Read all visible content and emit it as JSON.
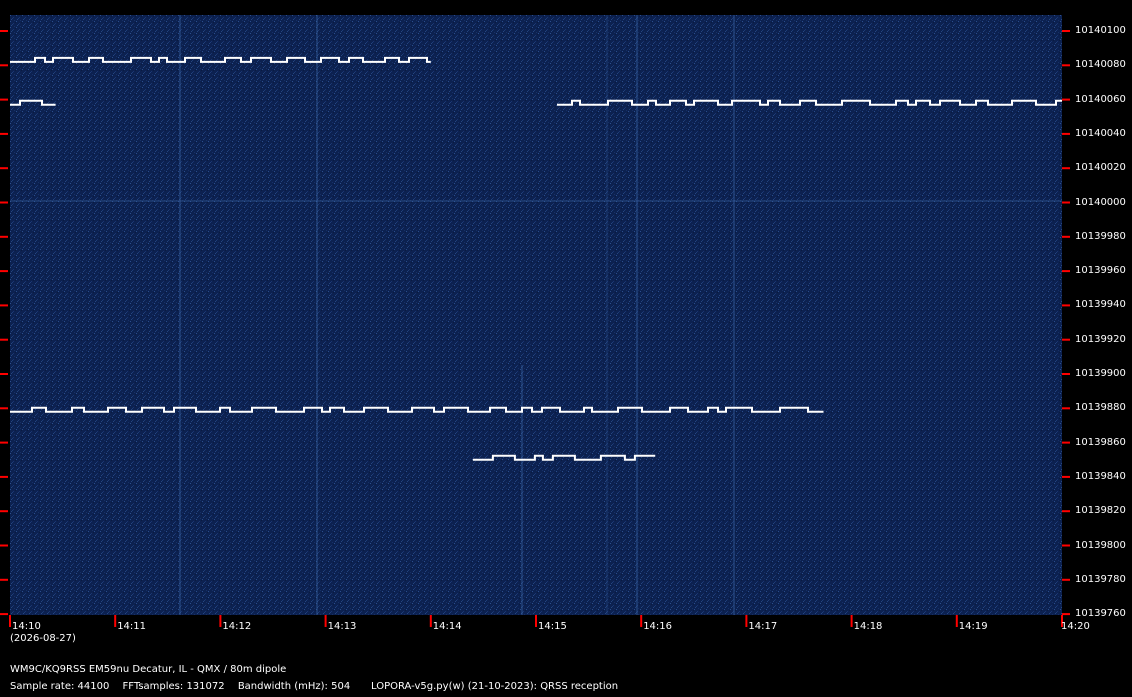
{
  "colors": {
    "background": "#000000",
    "waterfall": "#0c2150",
    "tick": "#ff0000",
    "signal": "#ffffff",
    "text": "#ffffff"
  },
  "frequency_axis": {
    "unit": "Hz",
    "labels": [
      "10140100",
      "10140080",
      "10140060",
      "10140040",
      "10140020",
      "10140000",
      "10139980",
      "10139960",
      "10139940",
      "10139920",
      "10139900",
      "10139880",
      "10139860",
      "10139840",
      "10139820",
      "10139800",
      "10139780",
      "10139760"
    ]
  },
  "time_axis": {
    "labels": [
      "14:10",
      "14:11",
      "14:12",
      "14:13",
      "14:14",
      "14:15",
      "14:16",
      "14:17",
      "14:18",
      "14:19",
      "14:20"
    ],
    "date": "(2026-08-27)"
  },
  "footer": {
    "station": "WM9C/KQ9RSS EM59nu Decatur, IL - QMX / 80m dipole",
    "sample_rate": "Sample rate: 44100",
    "fft_samples": "FFTsamples: 131072",
    "bandwidth": "Bandwidth (mHz): 504",
    "software": "LOPORA-v5g.py(w) (21-10-2023): QRSS reception"
  },
  "signals": [
    {
      "name": "trace-10139878",
      "freq": 10139878,
      "t_start": "14:10",
      "t_end": "14:17:44"
    },
    {
      "name": "trace-10140057",
      "freq": 10140057,
      "t_start": "14:15:12",
      "t_end": "14:20"
    },
    {
      "name": "trace-10140057-early",
      "freq": 10140057,
      "t_start": "14:10",
      "t_end": "14:10:26"
    },
    {
      "name": "trace-10140082",
      "freq": 10140082,
      "t_start": "14:10",
      "t_end": "14:14:00"
    },
    {
      "name": "trace-10139850",
      "freq": 10139850,
      "t_start": "14:14:24",
      "t_end": "14:16:08"
    }
  ]
}
